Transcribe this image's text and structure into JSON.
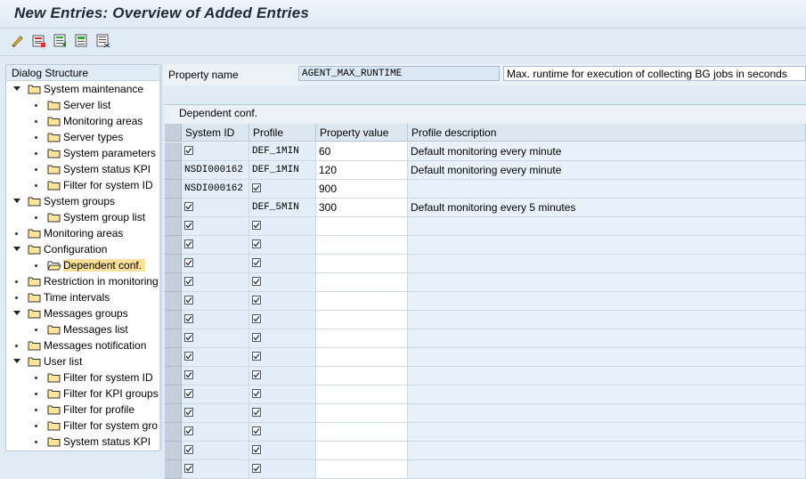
{
  "window": {
    "title": "New Entries: Overview of Added Entries"
  },
  "toolbar": {
    "icons": [
      "change-display-icon",
      "save-icon",
      "select-all-icon",
      "select-block-icon",
      "deselect-all-icon"
    ]
  },
  "tree": {
    "header": "Dialog Structure",
    "nodes": [
      {
        "label": "System maintenance",
        "level": 0,
        "expanded": true
      },
      {
        "label": "Server list",
        "level": 1
      },
      {
        "label": "Monitoring areas",
        "level": 1
      },
      {
        "label": "Server types",
        "level": 1
      },
      {
        "label": "System parameters",
        "level": 1
      },
      {
        "label": "System status KPI",
        "level": 1
      },
      {
        "label": "Filter for system ID",
        "level": 1
      },
      {
        "label": "System groups",
        "level": 0,
        "expanded": true
      },
      {
        "label": "System group list",
        "level": 1
      },
      {
        "label": "Monitoring areas",
        "level": 0
      },
      {
        "label": "Configuration",
        "level": 0,
        "expanded": true
      },
      {
        "label": "Dependent conf.",
        "level": 1,
        "selected": true
      },
      {
        "label": "Restriction in monitoring",
        "level": 0
      },
      {
        "label": "Time intervals",
        "level": 0
      },
      {
        "label": "Messages groups",
        "level": 0,
        "expanded": true
      },
      {
        "label": "Messages list",
        "level": 1
      },
      {
        "label": "Messages notification",
        "level": 0
      },
      {
        "label": "User list",
        "level": 0,
        "expanded": true
      },
      {
        "label": "Filter for system ID",
        "level": 1
      },
      {
        "label": "Filter for KPI groups",
        "level": 1
      },
      {
        "label": "Filter for profile",
        "level": 1
      },
      {
        "label": "Filter for system gro",
        "level": 1
      },
      {
        "label": "System status KPI",
        "level": 1
      }
    ]
  },
  "property": {
    "label": "Property name",
    "value": "AGENT_MAX_RUNTIME",
    "description": "Max. runtime for execution of collecting BG jobs in seconds"
  },
  "panel": {
    "title": "Dependent conf."
  },
  "table": {
    "columns": [
      "System ID",
      "Profile",
      "Property value",
      "Profile description"
    ],
    "rows": [
      {
        "system": "",
        "profile": "DEF_1MIN",
        "value": "60",
        "desc": "Default monitoring every minute"
      },
      {
        "system": "NSDI000162",
        "profile": "DEF_1MIN",
        "value": "120",
        "desc": "Default monitoring every minute"
      },
      {
        "system": "NSDI000162",
        "profile": "",
        "value": "900",
        "desc": ""
      },
      {
        "system": "",
        "profile": "DEF_5MIN",
        "value": "300",
        "desc": "Default monitoring every 5 minutes"
      },
      {
        "system": "",
        "profile": "",
        "value": "",
        "desc": ""
      },
      {
        "system": "",
        "profile": "",
        "value": "",
        "desc": ""
      },
      {
        "system": "",
        "profile": "",
        "value": "",
        "desc": ""
      },
      {
        "system": "",
        "profile": "",
        "value": "",
        "desc": ""
      },
      {
        "system": "",
        "profile": "",
        "value": "",
        "desc": ""
      },
      {
        "system": "",
        "profile": "",
        "value": "",
        "desc": ""
      },
      {
        "system": "",
        "profile": "",
        "value": "",
        "desc": ""
      },
      {
        "system": "",
        "profile": "",
        "value": "",
        "desc": ""
      },
      {
        "system": "",
        "profile": "",
        "value": "",
        "desc": ""
      },
      {
        "system": "",
        "profile": "",
        "value": "",
        "desc": ""
      },
      {
        "system": "",
        "profile": "",
        "value": "",
        "desc": ""
      },
      {
        "system": "",
        "profile": "",
        "value": "",
        "desc": ""
      },
      {
        "system": "",
        "profile": "",
        "value": "",
        "desc": ""
      },
      {
        "system": "",
        "profile": "",
        "value": "",
        "desc": ""
      }
    ]
  }
}
